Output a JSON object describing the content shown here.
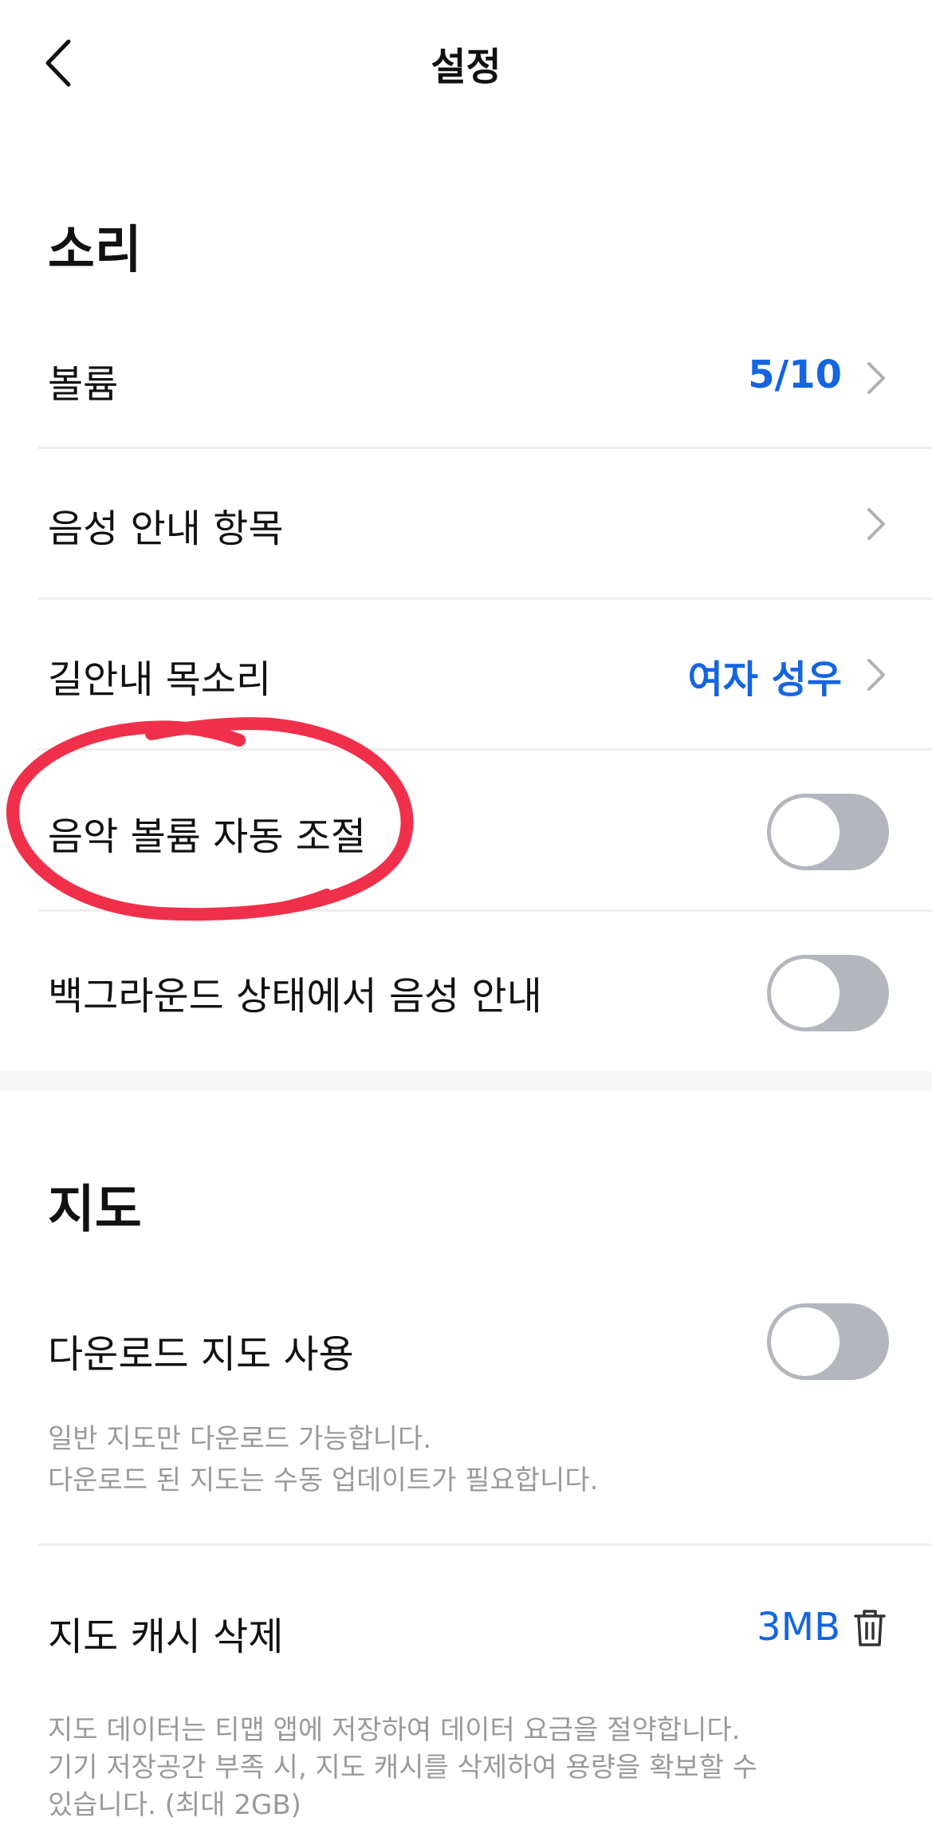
{
  "header": {
    "title": "설정",
    "back_icon": "chevron-left-icon"
  },
  "sections": {
    "sound": {
      "title": "소리",
      "volume": {
        "label": "볼륨",
        "value": "5/10"
      },
      "voice_guide_items": {
        "label": "음성 안내 항목"
      },
      "guide_voice": {
        "label": "길안내 목소리",
        "value": "여자 성우"
      },
      "auto_music_volume": {
        "label": "음악 볼륨 자동 조절",
        "enabled": false
      },
      "background_voice": {
        "label": "백그라운드 상태에서 음성 안내",
        "enabled": false
      }
    },
    "map": {
      "title": "지도",
      "download_map": {
        "label": "다운로드 지도 사용",
        "enabled": false
      },
      "download_desc_line1": "일반 지도만 다운로드 가능합니다.",
      "download_desc_line2": "다운로드 된 지도는 수동 업데이트가 필요합니다.",
      "clear_cache": {
        "label": "지도 캐시 삭제",
        "value": "3MB",
        "icon": "trash-icon"
      },
      "cache_desc_line1": "지도 데이터는 티맵 앱에 저장하여 데이터 요금을 절약합니다.",
      "cache_desc_line2": "기기 저장공간 부족 시, 지도 캐시를 삭제하여 용량을 확보할 수",
      "cache_desc_line3": "있습니다. (최대 2GB)"
    }
  },
  "colors": {
    "accent": "#1565e0",
    "toggle_off": "#b3b7bd",
    "annotation": "#f0304a"
  }
}
